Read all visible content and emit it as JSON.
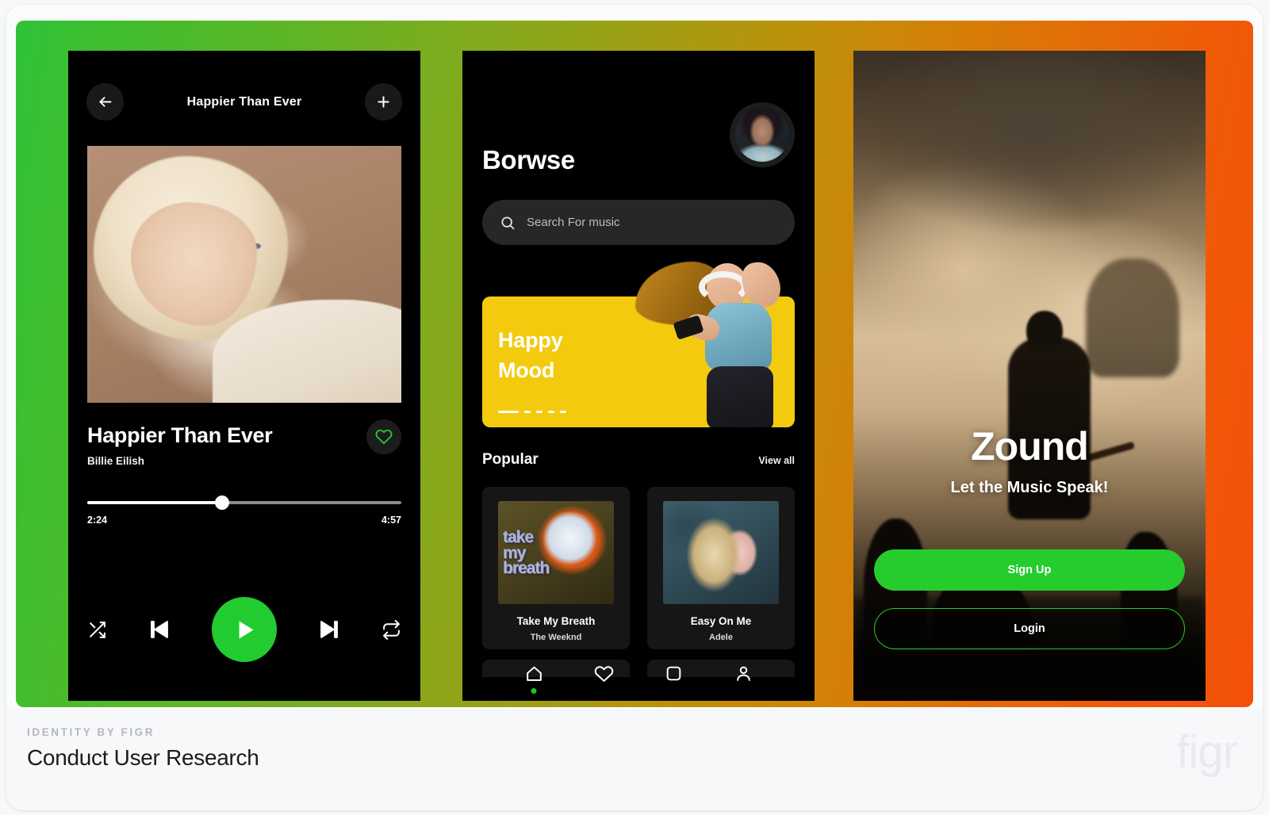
{
  "footer": {
    "kicker": "IDENTITY BY FIGR",
    "headline": "Conduct User Research",
    "watermark": "figr"
  },
  "theme": {
    "gradient_start": "#2fc23a",
    "gradient_mid": "#b8930c",
    "gradient_end": "#f4500a",
    "accent_green": "#22cc30",
    "banner_yellow": "#f4ca0f",
    "screen_bg": "#000000"
  },
  "screens": [
    {
      "id": "now-playing",
      "header": {
        "back_icon": "arrow-left-icon",
        "title": "Happier Than Ever",
        "add_icon": "plus-icon"
      },
      "album_art_alt": "Billie Eilish portrait album cover",
      "track": {
        "title": "Happier Than Ever",
        "artist": "Billie Eilish",
        "like_icon": "heart-icon",
        "liked": false
      },
      "progress": {
        "elapsed": "2:24",
        "total": "4:57",
        "percent": 43
      },
      "controls": [
        {
          "name": "shuffle-button",
          "icon": "shuffle-icon"
        },
        {
          "name": "previous-button",
          "icon": "skip-back-icon"
        },
        {
          "name": "play-button",
          "icon": "play-icon"
        },
        {
          "name": "next-button",
          "icon": "skip-forward-icon"
        },
        {
          "name": "repeat-button",
          "icon": "repeat-icon"
        }
      ]
    },
    {
      "id": "browse",
      "title": "Borwse",
      "avatar_alt": "User profile photo",
      "search": {
        "placeholder": "Search For music",
        "icon": "search-icon"
      },
      "banner": {
        "line1": "Happy",
        "line2": "Mood",
        "pagination": {
          "active": 0,
          "count": 5
        },
        "image_alt": "Woman dancing with headphones"
      },
      "popular": {
        "heading": "Popular",
        "view_all": "View all",
        "cards": [
          {
            "title": "Take My Breath",
            "artist": "The Weeknd",
            "cover_alt": "Take My Breath album cover"
          },
          {
            "title": "Easy On Me",
            "artist": "Adele",
            "cover_alt": "Easy On Me album cover"
          }
        ]
      },
      "tabs": [
        {
          "name": "tab-home",
          "icon": "home-icon",
          "active": true
        },
        {
          "name": "tab-favorites",
          "icon": "heart-icon",
          "active": false
        },
        {
          "name": "tab-library",
          "icon": "square-icon",
          "active": false
        },
        {
          "name": "tab-profile",
          "icon": "person-icon",
          "active": false
        }
      ]
    },
    {
      "id": "onboarding",
      "background_alt": "Concert crowd with raised hands and guitarist on stage",
      "app_name": "Zound",
      "tagline": "Let the Music Speak!",
      "primary_button": "Sign Up",
      "secondary_button": "Login"
    }
  ]
}
